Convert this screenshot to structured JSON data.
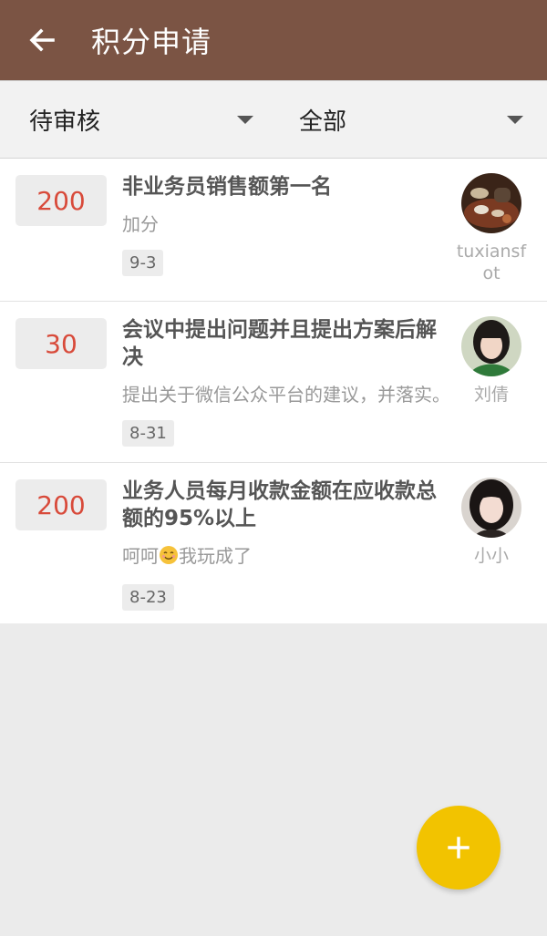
{
  "appbar": {
    "title": "积分申请",
    "back_icon": "arrow-left-icon"
  },
  "filters": [
    {
      "label": "待审核",
      "icon": "caret-down-icon"
    },
    {
      "label": "全部",
      "icon": "caret-down-icon"
    }
  ],
  "items": [
    {
      "points": "200",
      "title": "非业务员销售额第一名",
      "desc": "加分",
      "date": "9-3",
      "user": "tuxiansfot"
    },
    {
      "points": "30",
      "title": "会议中提出问题并且提出方案后解决",
      "desc": "提出关于微信公众平台的建议，并落实。",
      "date": "8-31",
      "user": "刘倩"
    },
    {
      "points": "200",
      "title": "业务人员每月收款金额在应收款总额的95%以上",
      "desc_prefix": "呵呵",
      "desc_suffix": "我玩成了",
      "desc_emoji": "smile-emoji-icon",
      "date": "8-23",
      "user": "小小"
    }
  ],
  "fab": {
    "label": "+",
    "icon": "plus-icon"
  },
  "colors": {
    "appbar": "#7b5444",
    "points_text": "#d84a3a",
    "fab": "#f2c300"
  }
}
